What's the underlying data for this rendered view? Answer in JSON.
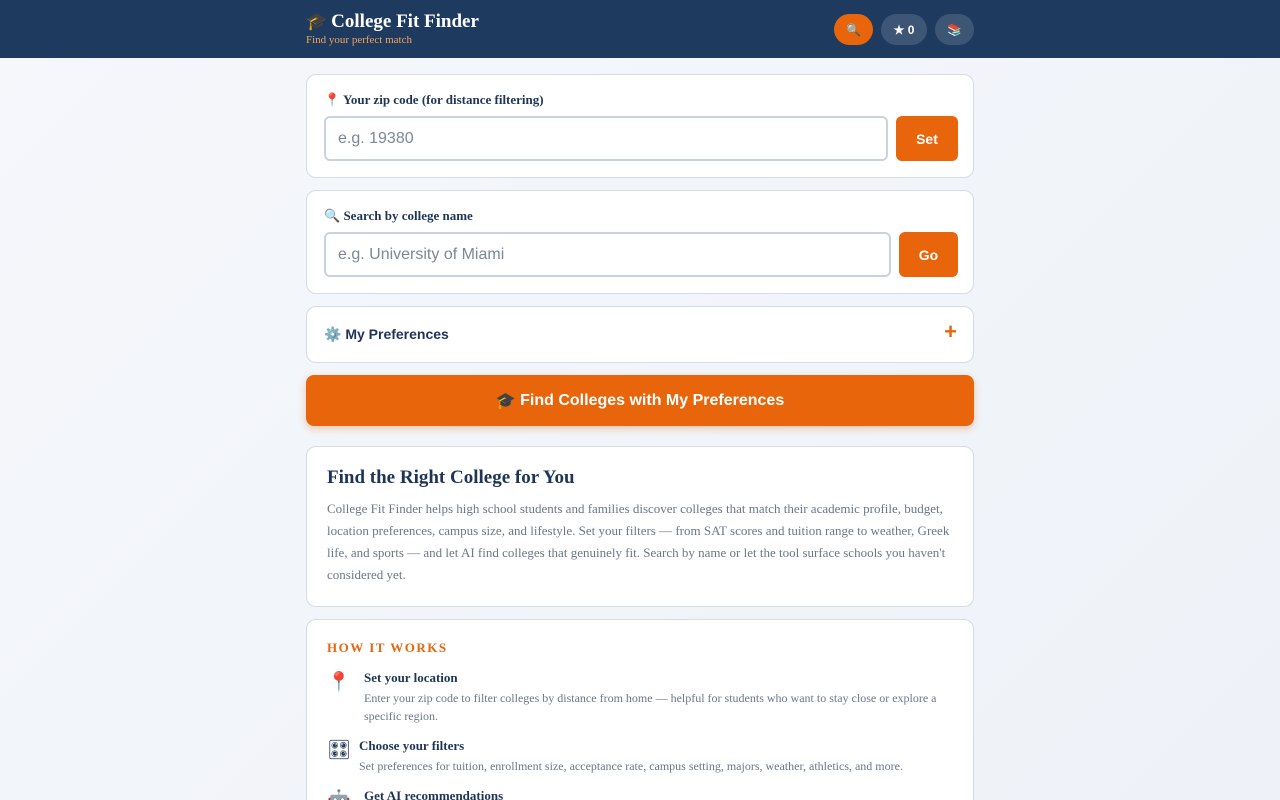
{
  "header": {
    "cap_icon": "🎓",
    "title": "College Fit Finder",
    "subtitle": "Find your perfect match",
    "search_icon": "🔍",
    "favorites_label": "★ 0",
    "library_icon": "📚"
  },
  "zip": {
    "icon": "📍",
    "label": "Your zip code (for distance filtering)",
    "placeholder": "e.g. 19380",
    "button": "Set"
  },
  "search": {
    "icon": "🔍",
    "label": "Search by college name",
    "placeholder": "e.g. University of Miami",
    "button": "Go"
  },
  "preferences": {
    "icon": "⚙️",
    "label": "My Preferences",
    "toggle": "+"
  },
  "find_button": {
    "icon": "🎓",
    "label": "Find Colleges with My Preferences"
  },
  "about": {
    "title": "Find the Right College for You",
    "body": "College Fit Finder helps high school students and families discover colleges that match their academic profile, budget, location preferences, campus size, and lifestyle. Set your filters — from SAT scores and tuition range to weather, Greek life, and sports — and let AI find colleges that genuinely fit. Search by name or let the tool surface schools you haven't considered yet."
  },
  "how_it_works": {
    "title": "HOW IT WORKS",
    "steps": [
      {
        "icon": "📍",
        "title": "Set your location",
        "desc": "Enter your zip code to filter colleges by distance from home — helpful for students who want to stay close or explore a specific region."
      },
      {
        "icon": "🎛",
        "title": "Choose your filters",
        "desc": "Set preferences for tuition, enrollment size, acceptance rate, campus setting, majors, weather, athletics, and more."
      },
      {
        "icon": "🤖",
        "title": "Get AI recommendations",
        "desc": ""
      }
    ]
  },
  "colors": {
    "navy": "#1e3a5f",
    "accent": "#e8650c",
    "muted_text": "#6c7787"
  }
}
